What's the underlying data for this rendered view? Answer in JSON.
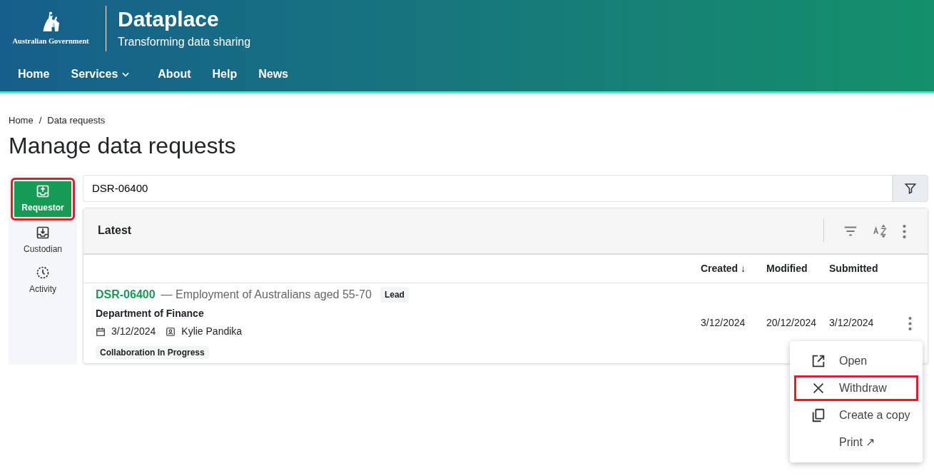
{
  "header": {
    "logo_text": "Australian Government",
    "title": "Dataplace",
    "subtitle": "Transforming data sharing"
  },
  "nav": [
    {
      "label": "Home",
      "dropdown": false
    },
    {
      "label": "Services",
      "dropdown": true
    },
    {
      "label": "About",
      "dropdown": false
    },
    {
      "label": "Help",
      "dropdown": false
    },
    {
      "label": "News",
      "dropdown": false
    }
  ],
  "breadcrumb": {
    "separator": "/",
    "items": [
      "Home",
      "Data requests"
    ]
  },
  "page_title": "Manage data requests",
  "side_nav": [
    {
      "label": "Requestor",
      "selected": true,
      "highlighted": true
    },
    {
      "label": "Custodian",
      "selected": false,
      "highlighted": false
    },
    {
      "label": "Activity",
      "selected": false,
      "highlighted": false
    }
  ],
  "search": {
    "value": "DSR-06400"
  },
  "list": {
    "title": "Latest",
    "columns": [
      {
        "label": "Created",
        "sort_mark": "↓"
      },
      {
        "label": "Modified"
      },
      {
        "label": "Submitted"
      }
    ],
    "rows": [
      {
        "id": "DSR-06400",
        "title": "— Employment of Australians aged 55-70",
        "tag": "Lead",
        "organisation": "Department of Finance",
        "date": "3/12/2024",
        "person": "Kylie Pandika",
        "status": "Collaboration In Progress",
        "cells": [
          "3/12/2024",
          "20/12/2024",
          "3/12/2024"
        ]
      }
    ]
  },
  "context_menu": {
    "items": [
      {
        "label": "Open",
        "highlighted": false
      },
      {
        "label": "Withdraw",
        "highlighted": true
      },
      {
        "label": "Create a copy",
        "highlighted": false
      },
      {
        "label": "Print",
        "suffix": "↗",
        "highlighted": false
      }
    ]
  }
}
